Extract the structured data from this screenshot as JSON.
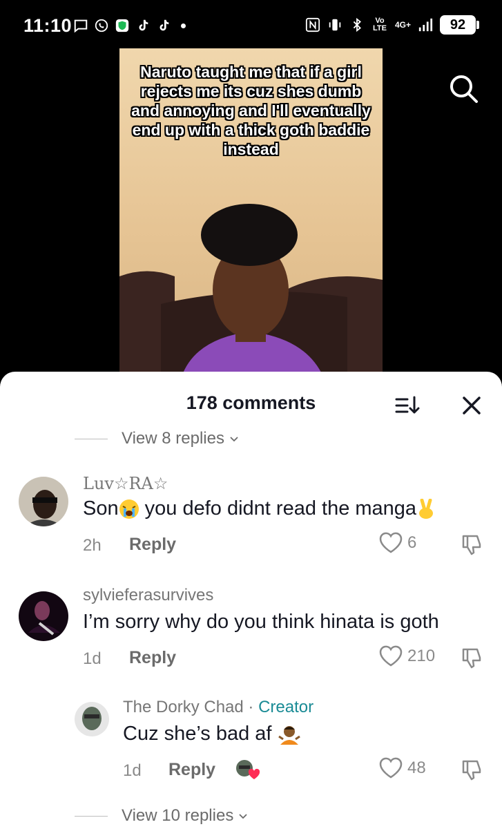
{
  "status_bar": {
    "time": "11:10",
    "battery": "92",
    "network": "4G+",
    "volte": "Vo LTE"
  },
  "video": {
    "caption": "Naruto taught me that if a girl rejects me its cuz shes dumb and annoying and I'll eventually end up with a thick goth baddie instead"
  },
  "comments_panel": {
    "count_label": "178 comments",
    "top_view_replies": "View 8 replies",
    "comments": [
      {
        "username": "Luv☆RA☆",
        "text_before": "Son",
        "text_after": " you defo didnt read the manga",
        "time": "2h",
        "reply_label": "Reply",
        "likes": "6"
      },
      {
        "username": "sylvieferasurvives",
        "text": "I’m sorry why do you think hinata is goth",
        "time": "1d",
        "reply_label": "Reply",
        "likes": "210"
      },
      {
        "username": "The Dorky Chad",
        "separator": " · ",
        "badge": "Creator",
        "text": "Cuz she’s bad af ",
        "time": "1d",
        "reply_label": "Reply",
        "likes": "48"
      }
    ],
    "bottom_view_replies": "View 10 replies"
  },
  "colors": {
    "sheet_bg": "#ffffff",
    "creator_badge": "#1a8b95",
    "text_primary": "#161823",
    "text_secondary": "#767676",
    "heart_red": "#fe2c55"
  },
  "icons": [
    "message-icon",
    "whatsapp-icon",
    "shield-icon",
    "tiktok-icon",
    "nfc-icon",
    "vibrate-icon",
    "bluetooth-icon",
    "signal-icon",
    "search-icon",
    "sort-icon",
    "close-icon",
    "heart-icon",
    "dislike-icon",
    "chevron-down-icon"
  ]
}
